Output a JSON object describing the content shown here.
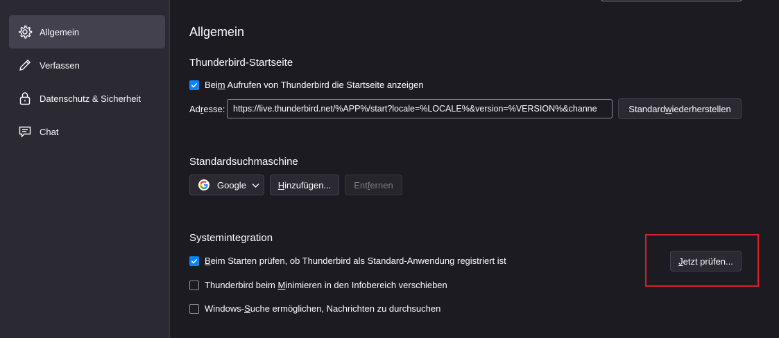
{
  "sidebar": {
    "items": [
      {
        "label": "Allgemein",
        "icon": "gear-icon",
        "selected": true
      },
      {
        "label": "Verfassen",
        "icon": "pencil-icon",
        "selected": false
      },
      {
        "label": "Datenschutz & Sicherheit",
        "icon": "lock-icon",
        "selected": false
      },
      {
        "label": "Chat",
        "icon": "chat-icon",
        "selected": false
      }
    ]
  },
  "main": {
    "title": "Allgemein",
    "startpage": {
      "heading": "Thunderbird-Startseite",
      "checkbox": {
        "pre": "Bei",
        "accesskey": "m",
        "post": " Aufrufen von Thunderbird die Startseite anzeigen",
        "checked": true
      },
      "address_label": {
        "pre": "Ad",
        "accesskey": "r",
        "post": "esse:"
      },
      "address_value": "https://live.thunderbird.net/%APP%/start?locale=%LOCALE%&version=%VERSION%&channe",
      "restore_button": {
        "pre": "Standard ",
        "accesskey": "w",
        "post": "iederherstellen"
      }
    },
    "search": {
      "heading": "Standardsuchmaschine",
      "engine": "Google",
      "engine_icon": "google-icon",
      "add_button": {
        "pre": "",
        "accesskey": "H",
        "post": "inzufügen..."
      },
      "remove_button": {
        "pre": "Ent",
        "accesskey": "f",
        "post": "ernen"
      }
    },
    "system": {
      "heading": "Systemintegration",
      "options": [
        {
          "pre": "",
          "accesskey": "B",
          "post": "eim Starten prüfen, ob Thunderbird als Standard-Anwendung registriert ist",
          "checked": true
        },
        {
          "pre": "Thunderbird beim ",
          "accesskey": "M",
          "post": "inimieren in den Infobereich verschieben",
          "checked": false
        },
        {
          "pre": "Windows-",
          "accesskey": "S",
          "post": "uche ermöglichen, Nachrichten zu durchsuchen",
          "checked": false
        }
      ],
      "check_button": {
        "pre": "",
        "accesskey": "J",
        "post": "etzt prüfen..."
      }
    },
    "colors": {
      "accent": "#0a84ff",
      "highlight": "#d7202a"
    }
  }
}
